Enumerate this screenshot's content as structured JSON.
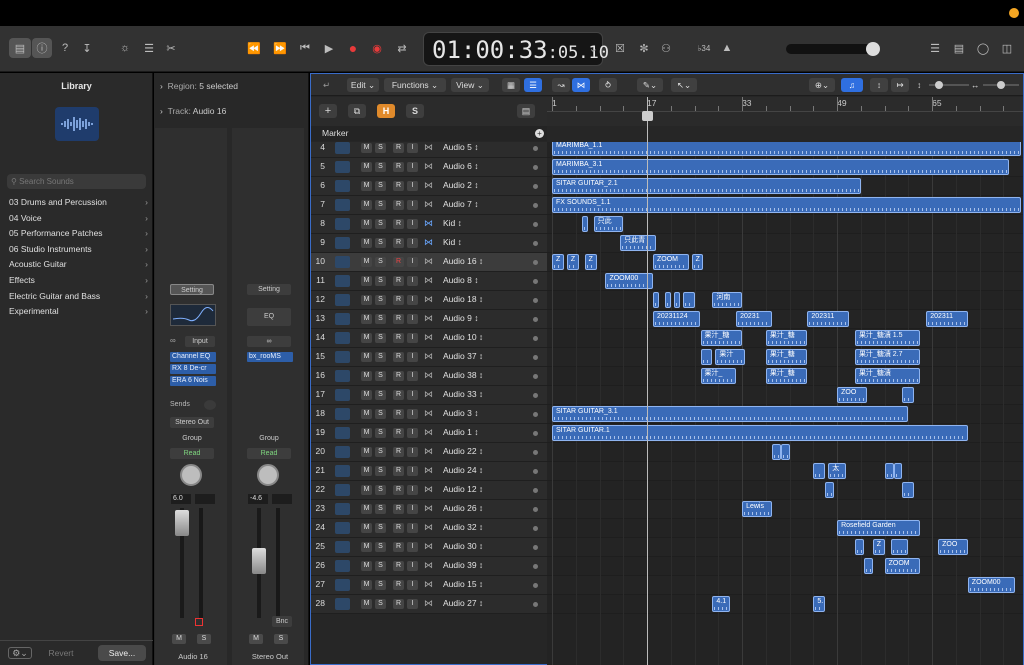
{
  "control_bar": {
    "lcd_time": "01:00:33",
    "lcd_frames": ":05.10",
    "key_display": "♭34",
    "icons": [
      "library-icon",
      "inspector-icon",
      "help-icon",
      "save-icon",
      "brightness-icon",
      "mixer-icon",
      "scissors-icon",
      "rewind-icon",
      "forward-icon",
      "to-start-icon",
      "play-icon",
      "record-icon",
      "capture-record-icon",
      "cycle-icon",
      "metronome-icon",
      "tuner-icon",
      "list-icon",
      "notepad-icon",
      "loop-browser-icon",
      "browser-icon"
    ]
  },
  "library": {
    "title": "Library",
    "search_placeholder": "Search Sounds",
    "items": [
      {
        "label": "03 Drums and Percussion"
      },
      {
        "label": "04 Voice"
      },
      {
        "label": "05 Performance Patches"
      },
      {
        "label": "06 Studio Instruments"
      },
      {
        "label": "Acoustic Guitar"
      },
      {
        "label": "Effects"
      },
      {
        "label": "Electric Guitar and Bass"
      },
      {
        "label": "Experimental"
      }
    ],
    "revert_label": "Revert",
    "save_label": "Save..."
  },
  "inspector": {
    "region_label": "Region:",
    "region_value": "5 selected",
    "track_label": "Track:",
    "track_value": "Audio 16",
    "strip1": {
      "setting": "Setting",
      "input": "Input",
      "plugins": [
        "Channel EQ",
        "RX 8 De-cr",
        "ERA 6 Nois"
      ],
      "sends": "Sends",
      "output": "Stereo Out",
      "group": "Group",
      "automation": "Read",
      "pan_value": "6.0",
      "mute": "M",
      "solo": "S",
      "name": "Audio 16"
    },
    "strip2": {
      "setting": "Setting",
      "eq": "EQ",
      "plugins": [
        "bx_rooMS"
      ],
      "group": "Group",
      "automation": "Read",
      "pan_value": "-4.6",
      "bounce": "Bnc",
      "mute": "M",
      "solo": "S",
      "name": "Stereo Out"
    }
  },
  "toolbar": {
    "edit": "Edit",
    "functions": "Functions",
    "view": "View"
  },
  "header": {
    "add": "+",
    "h_label": "H",
    "s_label": "S",
    "marker": "Marker"
  },
  "ruler": {
    "ticks": [
      "1",
      "17",
      "33",
      "49",
      "65",
      "8"
    ]
  },
  "tracks": [
    {
      "num": "4",
      "name": "Audio 5",
      "icon": "audio",
      "rec": false,
      "sel": false
    },
    {
      "num": "5",
      "name": "Audio 6",
      "icon": "audio",
      "rec": false,
      "sel": false
    },
    {
      "num": "6",
      "name": "Audio 2",
      "icon": "guitar",
      "rec": false,
      "sel": false
    },
    {
      "num": "7",
      "name": "Audio 7",
      "icon": "audio",
      "rec": false,
      "sel": false
    },
    {
      "num": "8",
      "name": "Kid",
      "icon": "audio",
      "rec": false,
      "sel": false
    },
    {
      "num": "9",
      "name": "Kid",
      "icon": "audio",
      "rec": false,
      "sel": false
    },
    {
      "num": "10",
      "name": "Audio 16",
      "icon": "audio",
      "rec": true,
      "sel": true
    },
    {
      "num": "11",
      "name": "Audio 8",
      "icon": "audio",
      "rec": false,
      "sel": false
    },
    {
      "num": "12",
      "name": "Audio 18",
      "icon": "audio",
      "rec": false,
      "sel": false
    },
    {
      "num": "13",
      "name": "Audio 9",
      "icon": "audio",
      "rec": false,
      "sel": false
    },
    {
      "num": "14",
      "name": "Audio 10",
      "icon": "audio",
      "rec": false,
      "sel": false
    },
    {
      "num": "15",
      "name": "Audio 37",
      "icon": "audio",
      "rec": false,
      "sel": false
    },
    {
      "num": "16",
      "name": "Audio 38",
      "icon": "audio",
      "rec": false,
      "sel": false
    },
    {
      "num": "17",
      "name": "Audio 33",
      "icon": "audio",
      "rec": false,
      "sel": false
    },
    {
      "num": "18",
      "name": "Audio 3",
      "icon": "guitar",
      "rec": false,
      "sel": false
    },
    {
      "num": "19",
      "name": "Audio 1",
      "icon": "audio",
      "rec": false,
      "sel": false
    },
    {
      "num": "20",
      "name": "Audio 22",
      "icon": "audio",
      "rec": false,
      "sel": false
    },
    {
      "num": "21",
      "name": "Audio 24",
      "icon": "audio",
      "rec": false,
      "sel": false
    },
    {
      "num": "22",
      "name": "Audio 12",
      "icon": "audio",
      "rec": false,
      "sel": false
    },
    {
      "num": "23",
      "name": "Audio 26",
      "icon": "audio",
      "rec": false,
      "sel": false
    },
    {
      "num": "24",
      "name": "Audio 32",
      "icon": "audio",
      "rec": false,
      "sel": false
    },
    {
      "num": "25",
      "name": "Audio 30",
      "icon": "audio",
      "rec": false,
      "sel": false
    },
    {
      "num": "26",
      "name": "Audio 39",
      "icon": "audio",
      "rec": false,
      "sel": false
    },
    {
      "num": "27",
      "name": "Audio 15",
      "icon": "audio",
      "rec": false,
      "sel": false
    },
    {
      "num": "28",
      "name": "Audio 27",
      "icon": "audio",
      "rec": false,
      "sel": false
    }
  ],
  "track_buttons": {
    "m": "M",
    "s": "S",
    "r": "R",
    "i": "I"
  },
  "regions": [
    {
      "track": 0,
      "start": 1,
      "len": 79,
      "label": "MARIMBA_1.1"
    },
    {
      "track": 1,
      "start": 1,
      "len": 77,
      "label": "MARIMBA_3.1"
    },
    {
      "track": 2,
      "start": 1,
      "len": 52,
      "label": "SITAR GUITAR_2.1"
    },
    {
      "track": 3,
      "start": 1,
      "len": 79,
      "label": "FX SOUNDS_1.1"
    },
    {
      "track": 4,
      "start": 6,
      "len": 1,
      "label": ""
    },
    {
      "track": 4,
      "start": 8,
      "len": 5,
      "label": "只此"
    },
    {
      "track": 5,
      "start": 12.5,
      "len": 6,
      "label": "只此青"
    },
    {
      "track": 6,
      "start": 1,
      "len": 2,
      "label": "Z"
    },
    {
      "track": 6,
      "start": 3.5,
      "len": 2,
      "label": "Z"
    },
    {
      "track": 6,
      "start": 6.5,
      "len": 2,
      "label": "Z"
    },
    {
      "track": 6,
      "start": 18,
      "len": 6,
      "label": "ZOOM"
    },
    {
      "track": 6,
      "start": 24.5,
      "len": 2,
      "label": "Z"
    },
    {
      "track": 7,
      "start": 10,
      "len": 8,
      "label": "ZOOM00"
    },
    {
      "track": 8,
      "start": 18,
      "len": 1,
      "label": ""
    },
    {
      "track": 8,
      "start": 20,
      "len": 1,
      "label": ""
    },
    {
      "track": 8,
      "start": 21.5,
      "len": 1,
      "label": ""
    },
    {
      "track": 8,
      "start": 23,
      "len": 2,
      "label": ""
    },
    {
      "track": 8,
      "start": 28,
      "len": 5,
      "label": "河南"
    },
    {
      "track": 9,
      "start": 18,
      "len": 8,
      "label": "20231124"
    },
    {
      "track": 9,
      "start": 32,
      "len": 6,
      "label": "20231"
    },
    {
      "track": 9,
      "start": 44,
      "len": 7,
      "label": "202311"
    },
    {
      "track": 9,
      "start": 64,
      "len": 7,
      "label": "202311"
    },
    {
      "track": 10,
      "start": 26,
      "len": 7,
      "label": "果汁_糖"
    },
    {
      "track": 10,
      "start": 37,
      "len": 7,
      "label": "果汁_糖"
    },
    {
      "track": 10,
      "start": 52,
      "len": 11,
      "label": "果汁_糖漬 1.5"
    },
    {
      "track": 11,
      "start": 26,
      "len": 2,
      "label": ""
    },
    {
      "track": 11,
      "start": 28.5,
      "len": 5,
      "label": "果汁"
    },
    {
      "track": 11,
      "start": 37,
      "len": 7,
      "label": "果汁_糖"
    },
    {
      "track": 11,
      "start": 52,
      "len": 11,
      "label": "果汁_糖漬 2.7"
    },
    {
      "track": 12,
      "start": 26,
      "len": 6,
      "label": "果汁_"
    },
    {
      "track": 12,
      "start": 37,
      "len": 7,
      "label": "果汁_糖"
    },
    {
      "track": 12,
      "start": 52,
      "len": 11,
      "label": "果汁_糖漬"
    },
    {
      "track": 13,
      "start": 49,
      "len": 5,
      "label": "ZOO"
    },
    {
      "track": 13,
      "start": 60,
      "len": 2,
      "label": ""
    },
    {
      "track": 14,
      "start": 1,
      "len": 60,
      "label": "SITAR GUITAR_3.1"
    },
    {
      "track": 15,
      "start": 1,
      "len": 70,
      "label": "SITAR GUITAR.1"
    },
    {
      "track": 16,
      "start": 38,
      "len": 1.5,
      "label": ""
    },
    {
      "track": 16,
      "start": 39.5,
      "len": 1.5,
      "label": ""
    },
    {
      "track": 17,
      "start": 45,
      "len": 2,
      "label": ""
    },
    {
      "track": 17,
      "start": 47.5,
      "len": 3,
      "label": "太"
    },
    {
      "track": 17,
      "start": 57,
      "len": 1.5,
      "label": ""
    },
    {
      "track": 17,
      "start": 58.5,
      "len": 1.5,
      "label": ""
    },
    {
      "track": 18,
      "start": 47,
      "len": 1.5,
      "label": ""
    },
    {
      "track": 18,
      "start": 60,
      "len": 2,
      "label": ""
    },
    {
      "track": 19,
      "start": 33,
      "len": 5,
      "label": "Lewis"
    },
    {
      "track": 20,
      "start": 49,
      "len": 14,
      "label": "Rosefield Garden"
    },
    {
      "track": 21,
      "start": 52,
      "len": 1.5,
      "label": ""
    },
    {
      "track": 21,
      "start": 55,
      "len": 2,
      "label": "Z"
    },
    {
      "track": 21,
      "start": 58,
      "len": 3,
      "label": ""
    },
    {
      "track": 21,
      "start": 66,
      "len": 5,
      "label": "ZOO"
    },
    {
      "track": 22,
      "start": 53.5,
      "len": 1.5,
      "label": ""
    },
    {
      "track": 22,
      "start": 57,
      "len": 6,
      "label": "ZOOM"
    },
    {
      "track": 23,
      "start": 71,
      "len": 8,
      "label": "ZOOM00"
    },
    {
      "track": 24,
      "start": 28,
      "len": 3,
      "label": "4.1"
    },
    {
      "track": 24,
      "start": 45,
      "len": 2,
      "label": "5."
    }
  ],
  "playhead_bar": 17
}
